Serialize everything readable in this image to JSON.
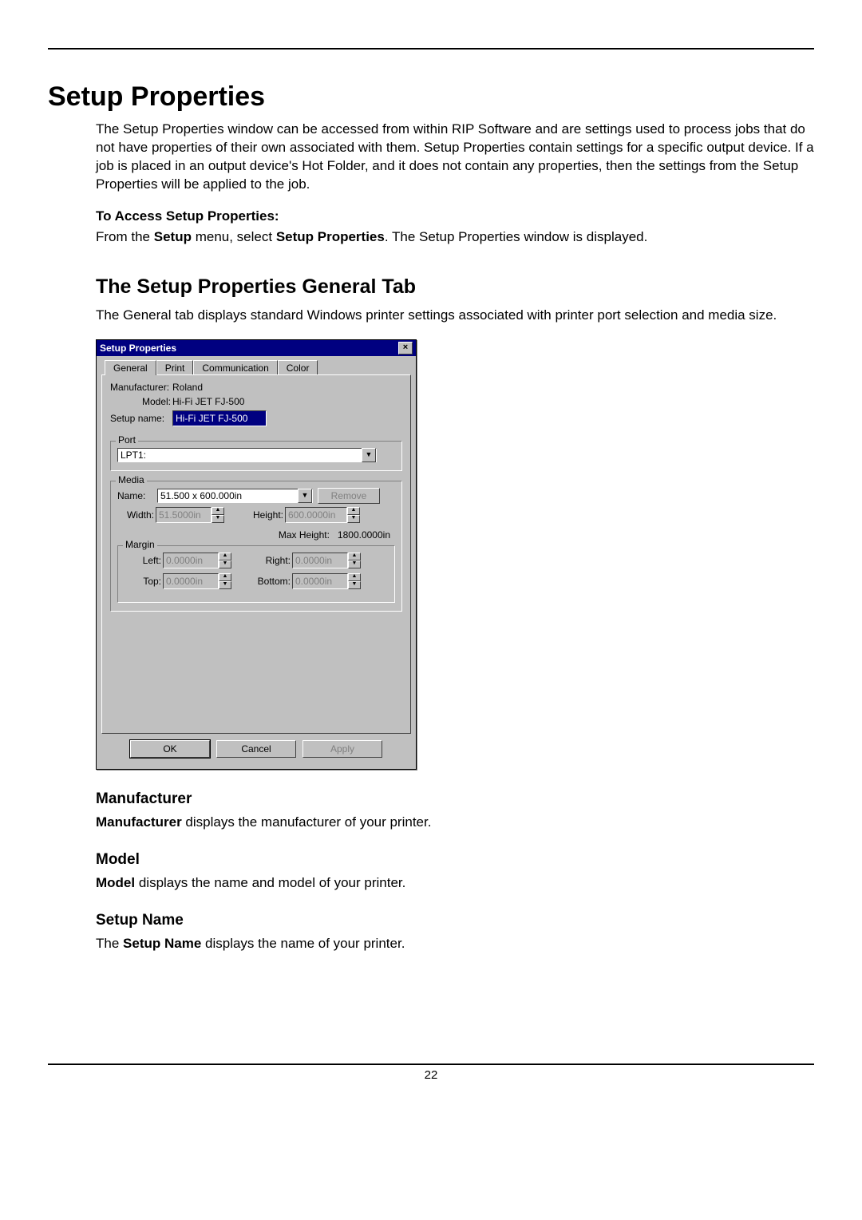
{
  "page": {
    "title": "Setup Properties",
    "intro": "The Setup Properties window can be accessed from within RIP Software and are settings used to process jobs that do not have properties of their own associated with them. Setup Properties contain settings for a specific output device. If a job is placed in an output device's Hot Folder, and it does not contain any properties, then the settings from the Setup Properties will be applied to the job.",
    "access_heading": "To Access Setup Properties:",
    "access_text_pre": "From the ",
    "access_text_b1": "Setup",
    "access_text_mid": " menu, select ",
    "access_text_b2": "Setup Properties",
    "access_text_post": ". The Setup Properties window is displayed.",
    "section_h2": "The Setup Properties General Tab",
    "section_desc": "The General tab displays standard Windows printer settings associated with printer port selection and media size.",
    "manufacturer_h": "Manufacturer",
    "manufacturer_b": "Manufacturer",
    "manufacturer_t": " displays the manufacturer of your printer.",
    "model_h": "Model",
    "model_b": "Model",
    "model_t": " displays the name and model of your printer.",
    "setupname_h": "Setup Name",
    "setupname_pre": "The ",
    "setupname_b": "Setup Name",
    "setupname_t": " displays the name of your printer.",
    "page_number": "22"
  },
  "dialog": {
    "title": "Setup Properties",
    "close_glyph": "×",
    "tabs": [
      "General",
      "Print",
      "Communication",
      "Color"
    ],
    "labels": {
      "manufacturer": "Manufacturer:",
      "model": "Model:",
      "setup_name": "Setup name:",
      "port_group": "Port",
      "media_group": "Media",
      "name": "Name:",
      "width": "Width:",
      "height": "Height:",
      "max_height": "Max Height:",
      "margin_group": "Margin",
      "left": "Left:",
      "right": "Right:",
      "top": "Top:",
      "bottom": "Bottom:",
      "remove": "Remove",
      "ok": "OK",
      "cancel": "Cancel",
      "apply": "Apply"
    },
    "values": {
      "manufacturer": "Roland",
      "model": "Hi-Fi JET FJ-500",
      "setup_name": "Hi-Fi JET FJ-500",
      "port": "LPT1:",
      "media_name": "51.500 x 600.000in",
      "width": "51.5000in",
      "height": "600.0000in",
      "max_height": "1800.0000in",
      "left": "0.0000in",
      "right": "0.0000in",
      "top": "0.0000in",
      "bottom": "0.0000in"
    }
  }
}
